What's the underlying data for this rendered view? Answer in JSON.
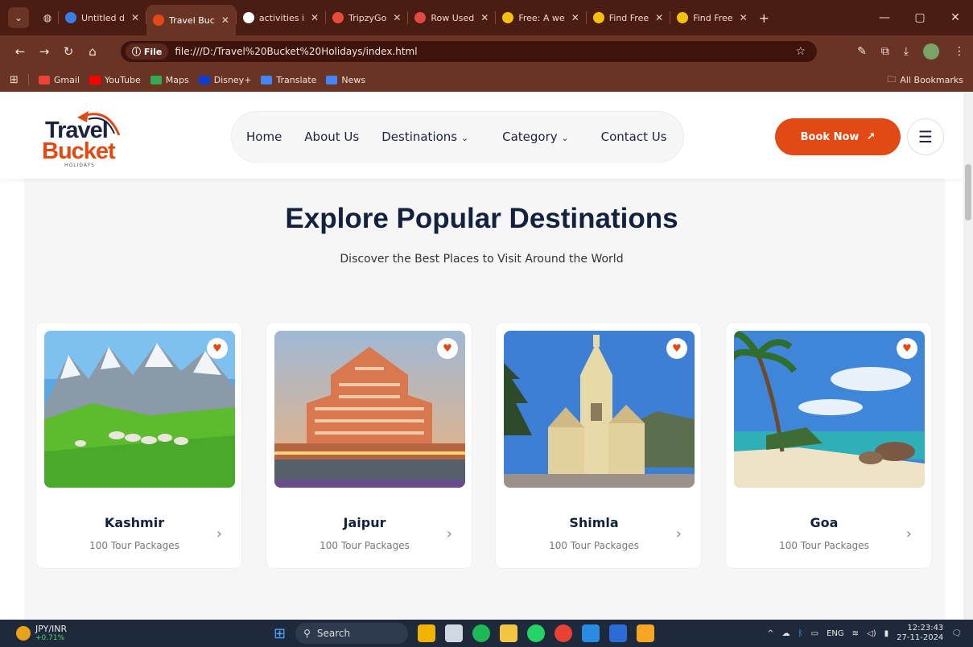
{
  "browser": {
    "tabs": [
      {
        "title": "Untitled d",
        "fav": "#3b7de9"
      },
      {
        "title": "Travel Buc",
        "fav": "#e14a14",
        "active": true
      },
      {
        "title": "activities i",
        "fav": "#ffffff"
      },
      {
        "title": "TripzyGo",
        "fav": "#e84a3c"
      },
      {
        "title": "Row Used",
        "fav": "#e14a44"
      },
      {
        "title": "Free: A we",
        "fav": "#f4c20d"
      },
      {
        "title": "Find Free",
        "fav": "#f4c20d"
      },
      {
        "title": "Find Free",
        "fav": "#f4c20d"
      }
    ],
    "file_chip": "File",
    "url": "file:///D:/Travel%20Bucket%20Holidays/index.html",
    "bookmarks": [
      {
        "label": "Gmail",
        "color": "#ea4335"
      },
      {
        "label": "YouTube",
        "color": "#ff0000"
      },
      {
        "label": "Maps",
        "color": "#34a853"
      },
      {
        "label": "Disney+",
        "color": "#113ccf"
      },
      {
        "label": "Translate",
        "color": "#4285f4"
      },
      {
        "label": "News",
        "color": "#4285f4"
      }
    ],
    "all_bookmarks": "All Bookmarks"
  },
  "site": {
    "logo": {
      "line1": "Travel",
      "line2": "Bucket",
      "line3": "HOLIDAYS"
    },
    "nav": [
      {
        "label": "Home"
      },
      {
        "label": "About Us"
      },
      {
        "label": "Destinations",
        "dropdown": true
      },
      {
        "label": "Category",
        "dropdown": true
      },
      {
        "label": "Contact Us"
      }
    ],
    "book_now": "Book Now",
    "section_title": "Explore Popular Destinations",
    "section_subtitle": "Discover the Best Places to Visit Around the World",
    "destinations": [
      {
        "name": "Kashmir",
        "packages": "100 Tour Packages"
      },
      {
        "name": "Jaipur",
        "packages": "100 Tour Packages"
      },
      {
        "name": "Shimla",
        "packages": "100 Tour Packages"
      },
      {
        "name": "Goa",
        "packages": "100 Tour Packages"
      }
    ]
  },
  "taskbar": {
    "ticker": "JPY/INR",
    "ticker_change": "+0.71%",
    "search": "Search",
    "lang": "ENG",
    "time": "12:23:43",
    "date": "27-11-2024"
  },
  "colors": {
    "accent": "#e14a14",
    "navy": "#12213d",
    "browser_frame": "#4a1c12"
  }
}
